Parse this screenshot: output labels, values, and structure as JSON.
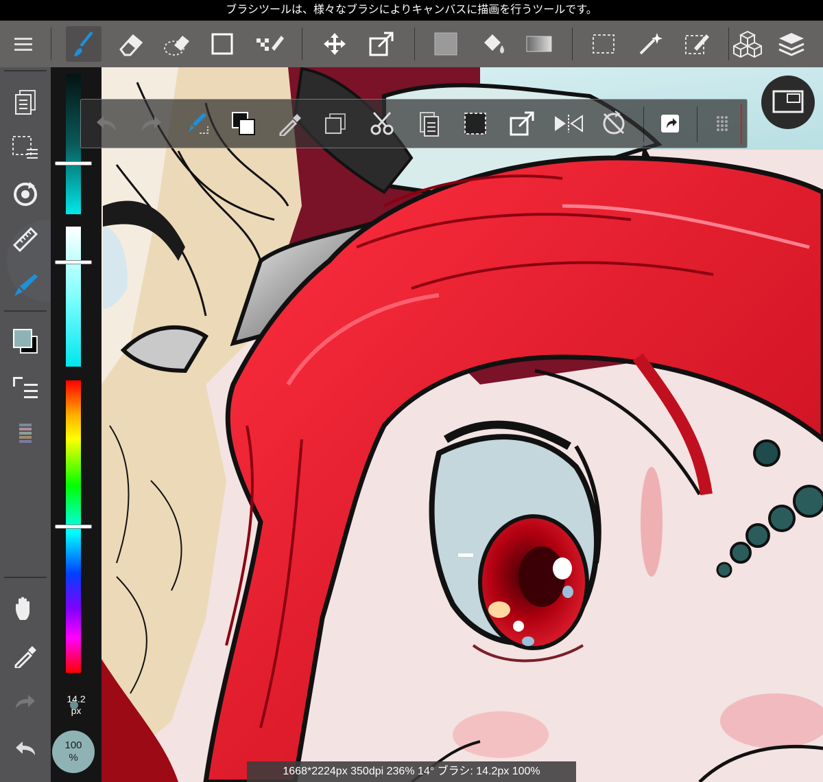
{
  "hint_bar": {
    "text": "ブラシツールは、様々なブラシによりキャンバスに描画を行うツールです。"
  },
  "main_toolbar": {
    "tools": [
      {
        "name": "menu",
        "icon": "hamburger-menu-icon",
        "active": false
      },
      {
        "name": "brush",
        "icon": "brush-icon",
        "active": true
      },
      {
        "name": "eraser",
        "icon": "eraser-icon",
        "active": false
      },
      {
        "name": "selection-eraser",
        "icon": "selection-eraser-icon",
        "active": false
      },
      {
        "name": "shape",
        "icon": "square-shape-icon",
        "active": false
      },
      {
        "name": "dot-pen",
        "icon": "dot-pen-icon",
        "active": false
      },
      {
        "name": "move",
        "icon": "move-arrows-icon",
        "active": false
      },
      {
        "name": "transform",
        "icon": "transform-icon",
        "active": false
      },
      {
        "name": "fill-color",
        "icon": "fill-square-icon",
        "active": false
      },
      {
        "name": "bucket",
        "icon": "paint-bucket-icon",
        "active": false
      },
      {
        "name": "gradient",
        "icon": "gradient-icon",
        "active": false
      },
      {
        "name": "select",
        "icon": "dashed-select-icon",
        "active": false
      },
      {
        "name": "magic-wand",
        "icon": "magic-wand-icon",
        "active": false
      },
      {
        "name": "select-pen",
        "icon": "select-pen-icon",
        "active": false
      },
      {
        "name": "materials",
        "icon": "cubes-icon",
        "active": false
      },
      {
        "name": "layers",
        "icon": "layers-icon",
        "active": false
      }
    ]
  },
  "edit_toolbar": {
    "buttons": [
      {
        "name": "undo",
        "icon": "undo-icon",
        "enabled": false
      },
      {
        "name": "redo",
        "icon": "redo-icon",
        "enabled": false
      },
      {
        "name": "brush-swap",
        "icon": "brush-swap-icon",
        "enabled": true
      },
      {
        "name": "color-swap",
        "icon": "color-swap-icon",
        "enabled": true
      },
      {
        "name": "eyedropper",
        "icon": "eyedropper-icon",
        "enabled": true
      },
      {
        "name": "copy",
        "icon": "copy-icon",
        "enabled": true
      },
      {
        "name": "cut",
        "icon": "scissors-icon",
        "enabled": true
      },
      {
        "name": "paste",
        "icon": "paste-icon",
        "enabled": true
      },
      {
        "name": "select-all",
        "icon": "select-all-icon",
        "enabled": true
      },
      {
        "name": "transform",
        "icon": "transform-icon",
        "enabled": true
      },
      {
        "name": "flip",
        "icon": "flip-horizontal-icon",
        "enabled": true
      },
      {
        "name": "reset-rotation",
        "icon": "reset-rotation-icon",
        "enabled": true
      },
      {
        "name": "share",
        "icon": "share-icon",
        "enabled": true
      },
      {
        "name": "more",
        "icon": "grip-dots-icon",
        "enabled": true
      }
    ]
  },
  "left_sidebar": {
    "buttons": [
      {
        "name": "layers-panel",
        "icon": "documents-icon"
      },
      {
        "name": "selection-menu",
        "icon": "selection-list-icon"
      },
      {
        "name": "rotate",
        "icon": "rotate-icon"
      },
      {
        "name": "ruler",
        "icon": "ruler-icon"
      },
      {
        "name": "brush-active",
        "icon": "brush-pen-icon"
      },
      {
        "name": "color",
        "icon": "color-swatch-icon"
      },
      {
        "name": "layer-list",
        "icon": "list-icon"
      },
      {
        "name": "palette",
        "icon": "palette-icon"
      },
      {
        "name": "hand",
        "icon": "hand-icon"
      },
      {
        "name": "eyedropper",
        "icon": "eyedropper-icon"
      },
      {
        "name": "redo",
        "icon": "redo-icon"
      },
      {
        "name": "undo",
        "icon": "undo-icon"
      }
    ],
    "primary_color": "#8fb3b5",
    "secondary_color": "#000000"
  },
  "color_column": {
    "brush_size": "14.2",
    "brush_unit": "px",
    "opacity_value": "100",
    "opacity_unit": "%"
  },
  "status_bar": {
    "text": "1668*2224px 350dpi 236% 14° ブラシ: 14.2px 100%"
  }
}
